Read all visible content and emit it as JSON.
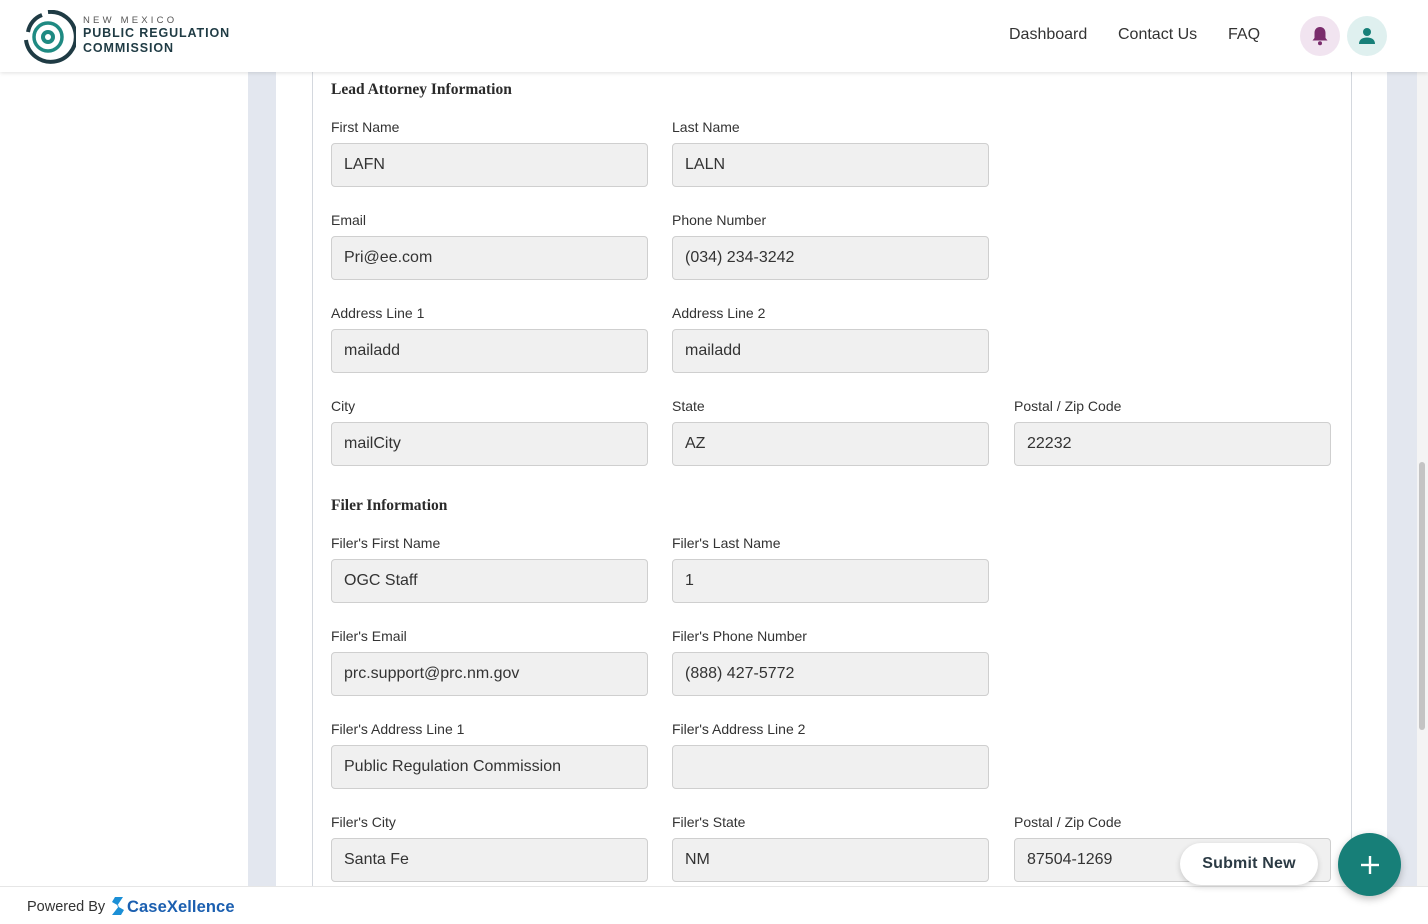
{
  "header": {
    "logo": {
      "line1": "NEW MEXICO",
      "line2": "PUBLIC REGULATION",
      "line3": "COMMISSION"
    },
    "nav": {
      "dashboard": "Dashboard",
      "contact": "Contact Us",
      "faq": "FAQ"
    },
    "icons": {
      "bell": "bell-icon",
      "user": "user-icon"
    }
  },
  "lead_attorney": {
    "title": "Lead Attorney Information",
    "first_name": {
      "label": "First Name",
      "value": "LAFN"
    },
    "last_name": {
      "label": "Last Name",
      "value": "LALN"
    },
    "email": {
      "label": "Email",
      "value": "Pri@ee.com"
    },
    "phone": {
      "label": "Phone Number",
      "value": "(034) 234-3242"
    },
    "address1": {
      "label": "Address Line 1",
      "value": "mailadd"
    },
    "address2": {
      "label": "Address Line 2",
      "value": "mailadd"
    },
    "city": {
      "label": "City",
      "value": "mailCity"
    },
    "state": {
      "label": "State",
      "value": "AZ"
    },
    "zip": {
      "label": "Postal / Zip Code",
      "value": "22232"
    }
  },
  "filer": {
    "title": "Filer Information",
    "first_name": {
      "label": "Filer's First Name",
      "value": "OGC Staff"
    },
    "last_name": {
      "label": "Filer's Last Name",
      "value": "1"
    },
    "email": {
      "label": "Filer's Email",
      "value": "prc.support@prc.nm.gov"
    },
    "phone": {
      "label": "Filer's Phone Number",
      "value": "(888) 427-5772"
    },
    "address1": {
      "label": "Filer's Address Line 1",
      "value": "Public Regulation Commission"
    },
    "address2": {
      "label": "Filer's Address Line 2",
      "value": ""
    },
    "city": {
      "label": "Filer's City",
      "value": "Santa Fe"
    },
    "state": {
      "label": "Filer's State",
      "value": "NM"
    },
    "zip": {
      "label": "Postal / Zip Code",
      "value": "87504-1269"
    }
  },
  "actions": {
    "submit_new": "Submit New",
    "fab_icon": "plus-icon"
  },
  "footer": {
    "powered_by": "Powered By",
    "brand": "CaseXellence"
  },
  "colors": {
    "teal": "#177f78",
    "bell": "#7a2c6c",
    "brand_blue": "#1b5fb0"
  }
}
